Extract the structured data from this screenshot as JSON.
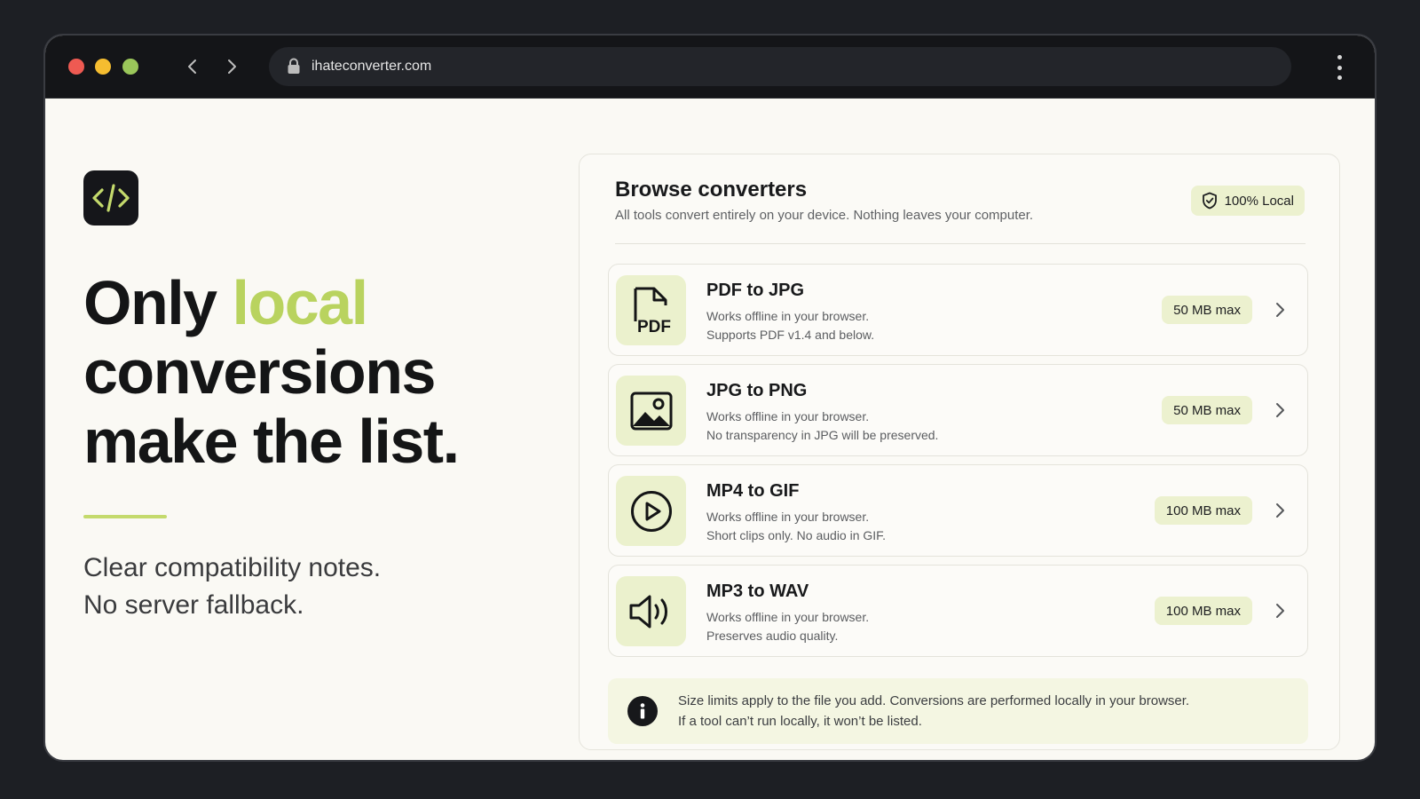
{
  "browser": {
    "url": "ihateconverter.com",
    "colors": {
      "close": "#ee5a52",
      "minimize": "#f5bd30",
      "zoom": "#9ac65a"
    }
  },
  "hero": {
    "logo_icon": "code-icon",
    "headline_part1": "Only ",
    "headline_accent": "local",
    "headline_part2": "conversions",
    "headline_part3": "make the list.",
    "subline1": "Clear compatibility notes.",
    "subline2": "No server fallback.",
    "accent_color": "#b9d35f"
  },
  "panel": {
    "title": "Browse converters",
    "description": "All tools convert entirely on your device. Nothing leaves your computer.",
    "badge_label": "100% Local",
    "badge_icon": "shield-check-icon",
    "converters": [
      {
        "name": "PDF to JPG",
        "line1": "Works offline in your browser.",
        "line2": "Supports PDF v1.4 and below.",
        "limit": "50 MB max",
        "icon": "pdf-file-icon",
        "icon_label": "PDF"
      },
      {
        "name": "JPG to PNG",
        "line1": "Works offline in your browser.",
        "line2": "No transparency in JPG will be preserved.",
        "limit": "50 MB max",
        "icon": "image-icon"
      },
      {
        "name": "MP4 to GIF",
        "line1": "Works offline in your browser.",
        "line2": "Short clips only. No audio in GIF.",
        "limit": "100 MB max",
        "icon": "play-icon"
      },
      {
        "name": "MP3 to WAV",
        "line1": "Works offline in your browser.",
        "line2": "Preserves audio quality.",
        "limit": "100 MB max",
        "icon": "speaker-icon"
      }
    ],
    "note_line1": "Size limits apply to the file you add. Conversions are performed locally in your browser.",
    "note_line2": "If a tool can’t run locally, it won’t be listed.",
    "note_icon": "info-icon"
  }
}
